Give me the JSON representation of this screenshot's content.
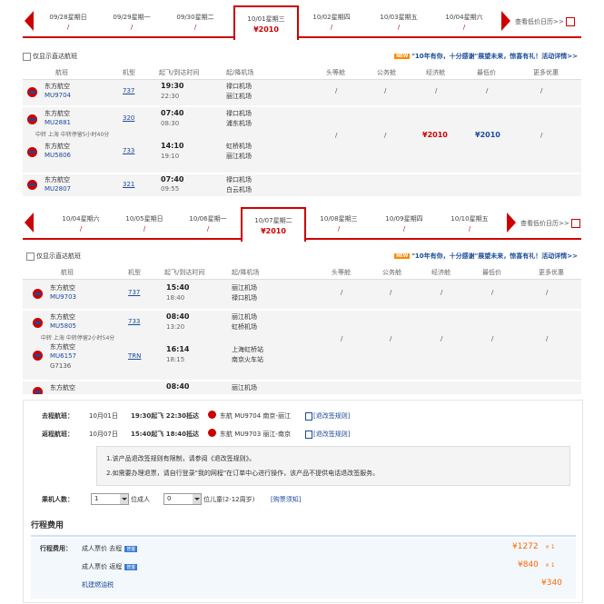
{
  "outbound_panel": {
    "dates": [
      {
        "label": "09/28星期日",
        "sub": "/"
      },
      {
        "label": "09/29星期一",
        "sub": "/"
      },
      {
        "label": "09/30星期二",
        "sub": "/"
      },
      {
        "label": "10/01星期三",
        "sub": "¥2010"
      },
      {
        "label": "10/02星期四",
        "sub": "/"
      },
      {
        "label": "10/03星期五",
        "sub": "/"
      },
      {
        "label": "10/04星期六",
        "sub": "/"
      }
    ],
    "calendar_link": "查看低价日历>>",
    "direct_only": "仅显示直达航班",
    "promo": "\"10年有你，十分感谢\"展望未来，惊喜有礼！活动详情>>",
    "promo_tag": "NEW",
    "headers": [
      "航班",
      "机型",
      "起飞/到达时间",
      "起/降机场",
      "头等舱",
      "公务舱",
      "经济舱",
      "最低价",
      "更多优惠"
    ],
    "flights": [
      {
        "airline": "东方航空",
        "number": "MU9704",
        "model": "737",
        "dep": "19:30",
        "arr": "22:30",
        "ap_dep": "禄口机场",
        "ap_arr": "丽江机场",
        "first": "/",
        "biz": "/",
        "eco": "",
        "low": "",
        "more": "/"
      },
      {
        "airline": "东方航空",
        "number": "MU2881",
        "model": "320",
        "dep": "07:40",
        "arr": "08:30",
        "ap_dep": "禄口机场",
        "ap_arr": "浦东机场"
      },
      {
        "airline": "东方航空",
        "number": "MU5806",
        "model": "733",
        "dep": "14:10",
        "arr": "19:10",
        "ap_dep": "虹桥机场",
        "ap_arr": "丽江机场"
      },
      {
        "airline": "东方航空",
        "number": "MU2807",
        "model": "321",
        "dep": "07:40",
        "arr": "09:55",
        "ap_dep": "禄口机场",
        "ap_arr": "白云机场"
      }
    ],
    "transfer_note": "中转 上海 中转停留5小时40分",
    "transfer_prices": {
      "first": "/",
      "biz": "/",
      "eco": "¥2010",
      "low": "¥2010",
      "more": "/"
    }
  },
  "return_panel": {
    "dates": [
      {
        "label": "10/04星期六",
        "sub": "/"
      },
      {
        "label": "10/05星期日",
        "sub": "/"
      },
      {
        "label": "10/06星期一",
        "sub": "/"
      },
      {
        "label": "10/07星期二",
        "sub": "¥2010"
      },
      {
        "label": "10/08星期三",
        "sub": "/"
      },
      {
        "label": "10/09星期四",
        "sub": "/"
      },
      {
        "label": "10/10星期五",
        "sub": "/"
      }
    ],
    "calendar_link": "查看低价日历>>",
    "direct_only": "仅显示直达航班",
    "promo": "\"10年有你，十分感谢\"展望未来，惊喜有礼！活动详情>>",
    "promo_tag": "NEW",
    "headers": [
      "航班",
      "机型",
      "起飞/到达时间",
      "起/降机场",
      "头等舱",
      "公务舱",
      "经济舱",
      "最低价",
      "更多优惠"
    ],
    "flights": [
      {
        "airline": "东方航空",
        "number": "MU9703",
        "model": "737",
        "dep": "15:40",
        "arr": "18:40",
        "ap_dep": "丽江机场",
        "ap_arr": "禄口机场",
        "first": "/",
        "biz": "/",
        "eco": "/",
        "low": "/",
        "more": "/"
      },
      {
        "airline": "东方航空",
        "number": "MU5805",
        "model": "733",
        "dep": "08:40",
        "arr": "13:20",
        "ap_dep": "丽江机场",
        "ap_arr": "虹桥机场"
      },
      {
        "airline": "东方航空",
        "number": "MU6157",
        "number2": "G7136",
        "model": "TRN",
        "dep": "16:14",
        "arr": "18:15",
        "ap_dep": "上海虹桥站",
        "ap_arr": "南京火车站"
      },
      {
        "airline": "东方航空",
        "number": "",
        "model": "",
        "dep": "08:40",
        "arr": "",
        "ap_dep": "丽江机场",
        "ap_arr": ""
      }
    ],
    "transfer_note": "中转 上海 中转停留2小时54分",
    "transfer_prices": {
      "first": "/",
      "biz": "/",
      "eco": "/",
      "low": "/",
      "more": "/"
    }
  },
  "summary": {
    "outbound_label": "去程航班：",
    "outbound_date": "10月01日",
    "outbound_time": "19:30起飞 22:30抵达",
    "outbound_flight": "东航 MU9704 南京-丽江",
    "outbound_link": "[退改签规则]",
    "return_label": "返程航班：",
    "return_date": "10月07日",
    "return_time": "15:40起飞 18:40抵达",
    "return_flight": "东航 MU9703 丽江-南京",
    "return_link": "[退改签规则]",
    "note1": "1.该产品退改签规则有限制，请参阅《退改签规则》。",
    "note2": "2.如需要办理退票，请自行登录\"我的网程\"在订单中心进行操作，该产品不提供电话退改签服务。",
    "passenger_label": "乘机人数：",
    "adult_count": "1",
    "adult_label": "位成人",
    "child_count": "0",
    "child_label": "位儿童(2-12周岁)",
    "book_link": "[购票须知]"
  },
  "costs": {
    "section_title": "行程费用",
    "label": "行程费用：",
    "items": [
      {
        "name": "成人票价 去程",
        "badge": "普客",
        "price": "¥1272",
        "mult": "× 1"
      },
      {
        "name": "成人票价 返程",
        "badge": "普客",
        "price": "¥840",
        "mult": "× 1"
      },
      {
        "name": "机建燃油税",
        "badge": "",
        "price": "¥340",
        "mult": ""
      }
    ]
  }
}
